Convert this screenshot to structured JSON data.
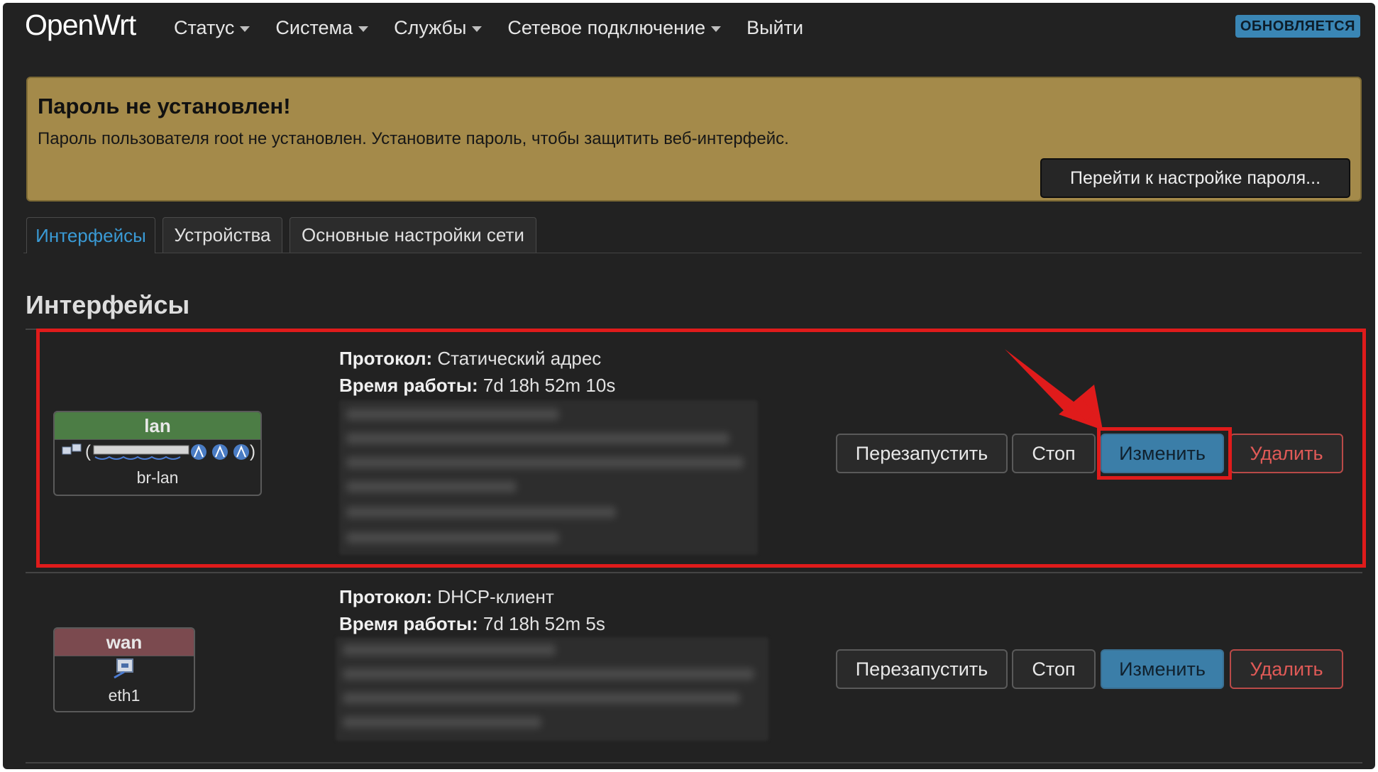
{
  "header": {
    "brand": "OpenWrt",
    "nav": [
      "Статус",
      "Система",
      "Службы",
      "Сетевое подключение",
      "Выйти"
    ],
    "status_label": "ОБНОВЛЯЕТСЯ"
  },
  "alert": {
    "title": "Пароль не установлен!",
    "text": "Пароль пользователя root не установлен. Установите пароль, чтобы защитить веб-интерфейс.",
    "button": "Перейти к настройке пароля..."
  },
  "tabs": [
    "Интерфейсы",
    "Устройства",
    "Основные настройки сети"
  ],
  "page_title": "Интерфейсы",
  "interfaces": [
    {
      "name": "lan",
      "device": "br-lan",
      "protocol_label": "Протокол:",
      "protocol": "Статический адрес",
      "uptime_label": "Время работы:",
      "uptime": "7d 18h 52m 10s"
    },
    {
      "name": "wan",
      "device": "eth1",
      "protocol_label": "Протокол:",
      "protocol": "DHCP-клиент",
      "uptime_label": "Время работы:",
      "uptime": "7d 18h 52m 5s"
    }
  ],
  "actions": {
    "restart": "Перезапустить",
    "stop": "Стоп",
    "edit": "Изменить",
    "delete": "Удалить"
  },
  "colors": {
    "background": "#222222",
    "alert": "#a48a4a",
    "edit_button": "#3b7ea8",
    "delete_border": "#b94a48",
    "lan_header": "#4c7d45",
    "wan_header": "#7b4a4f",
    "annotation": "#e01b1b"
  },
  "icons": [
    "caret-down-icon",
    "ethernet-port-icon",
    "wireless-icon",
    "arrow-annotation"
  ]
}
